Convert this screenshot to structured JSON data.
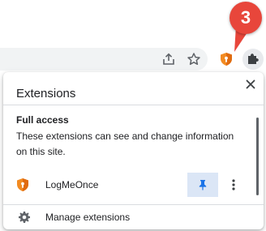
{
  "step_marker": {
    "number": "3",
    "color": "#e8463b"
  },
  "toolbar": {
    "icons": [
      "share-icon",
      "star-icon",
      "logmeonce-shield-icon",
      "puzzle-icon"
    ]
  },
  "popup": {
    "title": "Extensions",
    "close_icon": "close-icon",
    "section": {
      "heading": "Full access",
      "description": "These extensions can see and change information on this site."
    },
    "extensions": [
      {
        "name": "LogMeOnce",
        "icon": "logmeonce-shield-icon",
        "pinned": true
      }
    ],
    "manage": {
      "label": "Manage extensions",
      "icon": "gear-icon"
    }
  },
  "colors": {
    "accent": "#1a73e8",
    "pin_highlight": "#dbe6f6",
    "shield_orange": "#f28b22"
  }
}
